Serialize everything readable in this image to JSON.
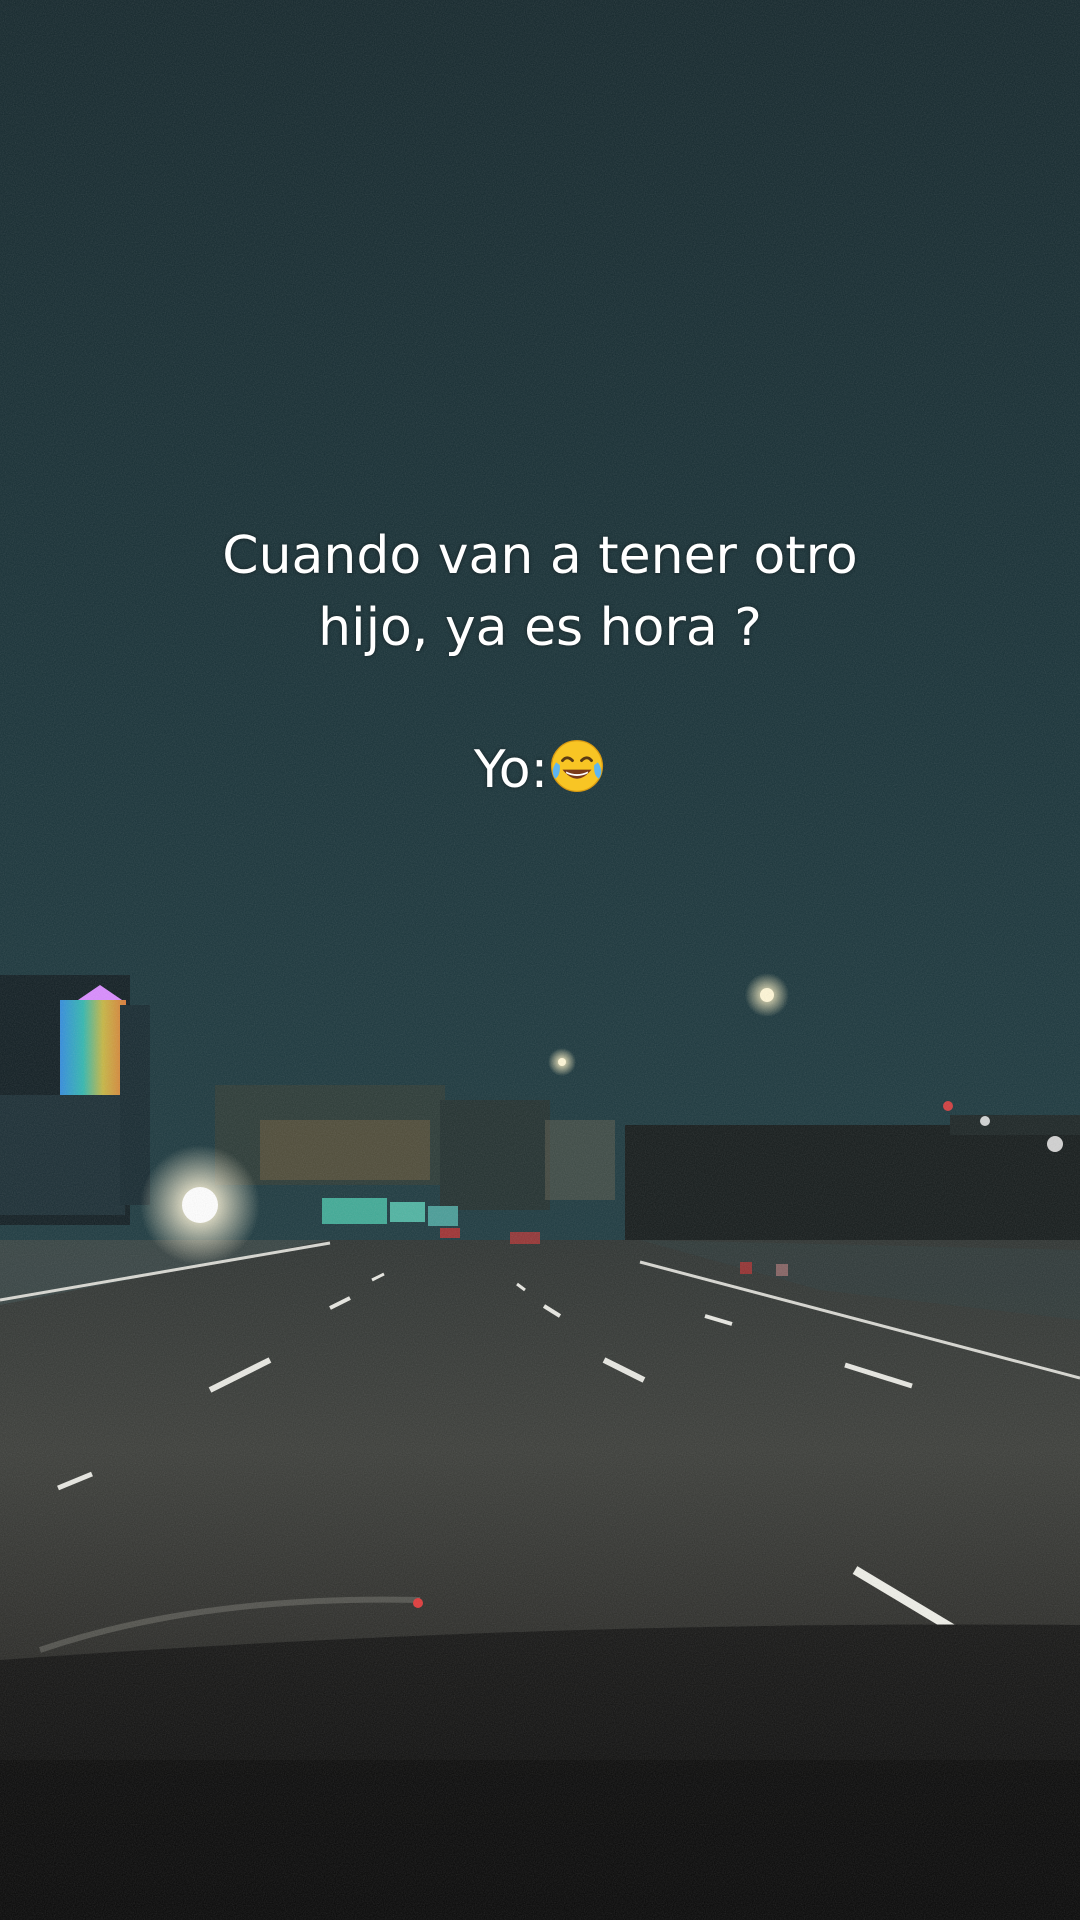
{
  "caption": {
    "line1": "Cuando van a tener otro",
    "line2": "hijo, ya es hora ?",
    "line3": "Yo:"
  },
  "emoji": "face-with-tears-of-joy-icon",
  "colors": {
    "sky_top": "#13262b",
    "sky_mid": "#173137",
    "road": "#3a3a37",
    "dashboard": "#0b0b0a",
    "text": "#ffffff"
  }
}
